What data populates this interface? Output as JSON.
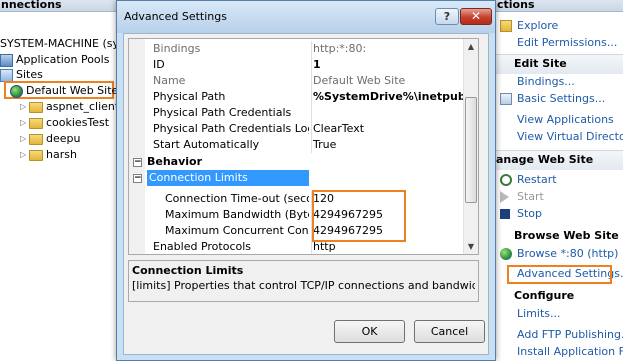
{
  "left_pane": {
    "header": "nnections",
    "tree": {
      "machine": "SYSTEM-MACHINE (syste",
      "app_pools": "Application Pools",
      "sites": "Sites",
      "default_site": "Default Web Site",
      "children": [
        "aspnet_client",
        "cookiesTest",
        "deepu",
        "harsh"
      ]
    }
  },
  "dialog": {
    "title": "Advanced Settings",
    "help": "?",
    "close": "✕",
    "grid": {
      "rows": [
        {
          "name": "Bindings",
          "value": "http:*:80:"
        },
        {
          "name": "ID",
          "value": "1"
        },
        {
          "name": "Name",
          "value": "Default Web Site"
        },
        {
          "name": "Physical Path",
          "value": "%SystemDrive%\\inetpub\\wwwroo"
        },
        {
          "name": "Physical Path Credentials",
          "value": ""
        },
        {
          "name": "Physical Path Credentials Logon T",
          "value": "ClearText"
        },
        {
          "name": "Start Automatically",
          "value": "True"
        }
      ],
      "behavior_category": "Behavior",
      "connection_limits": "Connection Limits",
      "limits": [
        {
          "name": "Connection Time-out (seconds",
          "value": "120"
        },
        {
          "name": "Maximum Bandwidth (Bytes/se",
          "value": "4294967295"
        },
        {
          "name": "Maximum Concurrent Connect",
          "value": "4294967295"
        }
      ],
      "enabled_protocols": {
        "name": "Enabled Protocols",
        "value": "http"
      },
      "expanded_glyph": "−"
    },
    "description": {
      "title": "Connection Limits",
      "text": "[limits] Properties that control TCP/IP connections and bandwidth."
    },
    "buttons": {
      "ok": "OK",
      "cancel": "Cancel"
    }
  },
  "right_pane": {
    "header": "ctions",
    "items": {
      "explore": "Explore",
      "edit_permissions": "Edit Permissions...",
      "edit_site": "Edit Site",
      "bindings": "Bindings...",
      "basic_settings": "Basic Settings...",
      "view_applications": "View Applications",
      "view_virtual_dirs": "View Virtual Directories",
      "manage_web_site": "anage Web Site",
      "restart": "Restart",
      "start": "Start",
      "stop": "Stop",
      "browse_web_site": "Browse Web Site",
      "browse_80": "Browse *:80 (http)",
      "advanced_settings": "Advanced Settings...",
      "configure": "Configure",
      "limits": "Limits...",
      "add_ftp": "Add FTP Publishing...",
      "install_app": "Install Application From"
    }
  },
  "colors": {
    "highlight_border": "#f07f1e",
    "link": "#1e5aa8",
    "selection": "#3399ff"
  }
}
